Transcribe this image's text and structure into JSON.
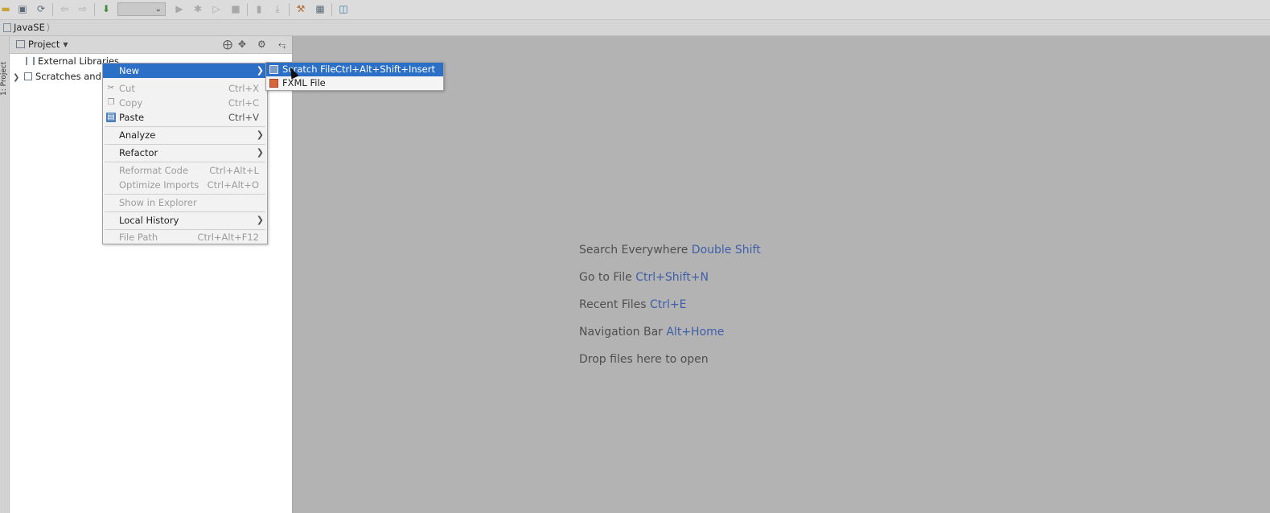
{
  "toolbar": {
    "run_config_value": "",
    "icons": [
      "open-folder-icon",
      "save-icon",
      "sync-icon",
      "back-icon",
      "forward-icon",
      "build-icon",
      "run-icon",
      "debug-icon",
      "run-coverage-icon",
      "stop-icon",
      "bookmark-icon",
      "download-icon",
      "project-structure-icon",
      "settings-icon",
      "sdk-icon"
    ]
  },
  "breadcrumb": {
    "project": "JavaSE"
  },
  "left_strip": {
    "project_tab": "1: Project"
  },
  "project_panel": {
    "title": "Project",
    "tree": [
      {
        "label": "External Libraries"
      },
      {
        "label": "Scratches and Consoles"
      }
    ]
  },
  "context_menu": {
    "items": [
      {
        "label": "New",
        "shortcut": "",
        "submenu": true,
        "selected": true,
        "disabled": false
      },
      {
        "label": "Cut",
        "shortcut": "Ctrl+X",
        "disabled": true
      },
      {
        "label": "Copy",
        "shortcut": "Ctrl+C",
        "disabled": true
      },
      {
        "label": "Paste",
        "shortcut": "Ctrl+V",
        "disabled": false
      },
      {
        "label": "Analyze",
        "shortcut": "",
        "submenu": true,
        "disabled": false
      },
      {
        "label": "Refactor",
        "shortcut": "",
        "submenu": true,
        "disabled": false
      },
      {
        "label": "Reformat Code",
        "shortcut": "Ctrl+Alt+L",
        "disabled": true
      },
      {
        "label": "Optimize Imports",
        "shortcut": "Ctrl+Alt+O",
        "disabled": true
      },
      {
        "label": "Show in Explorer",
        "shortcut": "",
        "disabled": true
      },
      {
        "label": "Local History",
        "shortcut": "",
        "submenu": true,
        "disabled": false
      },
      {
        "label": "File Path",
        "shortcut": "Ctrl+Alt+F12",
        "disabled": true
      }
    ]
  },
  "submenu": {
    "items": [
      {
        "label": "Scratch File",
        "shortcut": "Ctrl+Alt+Shift+Insert",
        "selected": true
      },
      {
        "label": "FXML File",
        "shortcut": ""
      }
    ]
  },
  "editor_hints": [
    {
      "text": "Search Everywhere",
      "key": "Double Shift"
    },
    {
      "text": "Go to File",
      "key": "Ctrl+Shift+N"
    },
    {
      "text": "Recent Files",
      "key": "Ctrl+E"
    },
    {
      "text": "Navigation Bar",
      "key": "Alt+Home"
    },
    {
      "text": "Drop files here to open",
      "key": ""
    }
  ],
  "colors": {
    "selection": "#2c6fc7",
    "shortcut_key": "#3f5fa8",
    "editor_bg": "#b3b3b3"
  }
}
